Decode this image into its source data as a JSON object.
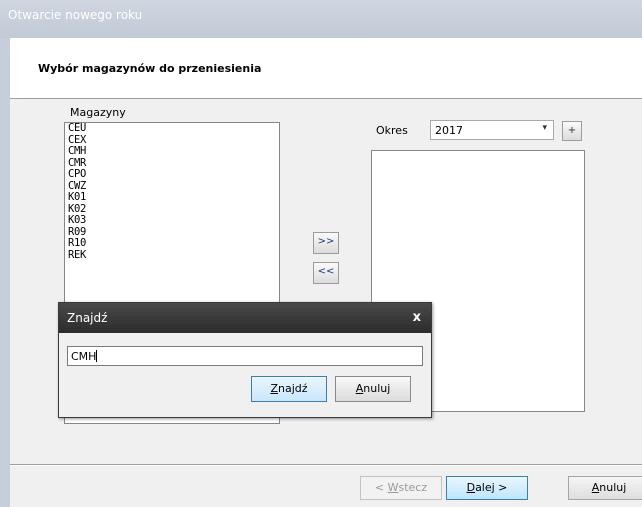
{
  "window": {
    "title": "Otwarcie nowego roku"
  },
  "header": {
    "title": "Wybór magazynów do przeniesienia"
  },
  "warehouses": {
    "label": "Magazyny",
    "items": [
      "CEU",
      "CEX",
      "CMH",
      "CMR",
      "CPO",
      "CWZ",
      "K01",
      "K02",
      "K03",
      "R09",
      "R10",
      "REK"
    ]
  },
  "period": {
    "label": "Okres",
    "selected": "2017",
    "add_label": "+"
  },
  "move": {
    "right_label": ">>",
    "left_label": "<<"
  },
  "selected_list": {
    "items": []
  },
  "nav": {
    "back_prefix": "< ",
    "back_key": "W",
    "back_rest": "stecz",
    "next_key": "D",
    "next_rest": "alej >",
    "cancel_key": "A",
    "cancel_rest": "nuluj"
  },
  "find_dialog": {
    "title": "Znajdź",
    "close": "x",
    "input_value": "CMH",
    "find_key": "Z",
    "find_rest": "najdź",
    "cancel_key": "A",
    "cancel_rest": "nuluj"
  }
}
